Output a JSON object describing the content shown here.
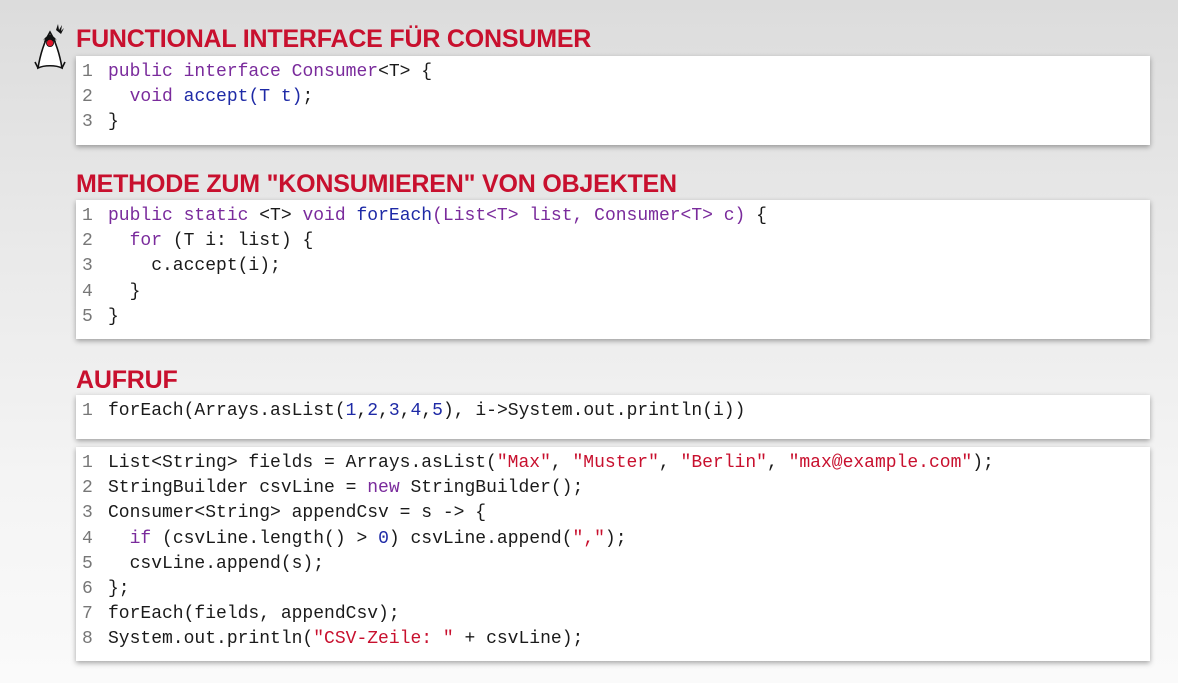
{
  "sections": [
    {
      "heading": "FUNCTIONAL INTERFACE FÜR CONSUMER",
      "blocks": [
        {
          "lines": [
            {
              "n": "1",
              "tokens": [
                [
                  "kw",
                  "public"
                ],
                [
                  "p",
                  " "
                ],
                [
                  "kw",
                  "interface"
                ],
                [
                  "p",
                  " "
                ],
                [
                  "ty",
                  "Consumer"
                ],
                [
                  "p",
                  "<T> {"
                ]
              ]
            },
            {
              "n": "2",
              "tokens": [
                [
                  "p",
                  "  "
                ],
                [
                  "kw",
                  "void"
                ],
                [
                  "p",
                  " "
                ],
                [
                  "fn",
                  "accept(T t)"
                ],
                [
                  "p",
                  ";"
                ]
              ]
            },
            {
              "n": "3",
              "tokens": [
                [
                  "p",
                  "}"
                ]
              ]
            }
          ]
        }
      ]
    },
    {
      "heading": "METHODE ZUM \"KONSUMIEREN\" VON OBJEKTEN",
      "blocks": [
        {
          "lines": [
            {
              "n": "1",
              "tokens": [
                [
                  "kw",
                  "public"
                ],
                [
                  "p",
                  " "
                ],
                [
                  "kw",
                  "static"
                ],
                [
                  "p",
                  " <T> "
                ],
                [
                  "kw",
                  "void"
                ],
                [
                  "p",
                  " "
                ],
                [
                  "fn",
                  "forEach"
                ],
                [
                  "ty",
                  "(List<T> list, Consumer<T> c)"
                ],
                [
                  "p",
                  " {"
                ]
              ]
            },
            {
              "n": "2",
              "tokens": [
                [
                  "p",
                  "  "
                ],
                [
                  "kw",
                  "for"
                ],
                [
                  "p",
                  " (T i: list) {"
                ]
              ]
            },
            {
              "n": "3",
              "tokens": [
                [
                  "p",
                  "    c.accept(i);"
                ]
              ]
            },
            {
              "n": "4",
              "tokens": [
                [
                  "p",
                  "  }"
                ]
              ]
            },
            {
              "n": "5",
              "tokens": [
                [
                  "p",
                  "}"
                ]
              ]
            }
          ]
        }
      ]
    },
    {
      "heading": "AUFRUF",
      "blocks": [
        {
          "lines": [
            {
              "n": "1",
              "tokens": [
                [
                  "p",
                  "forEach(Arrays.asList("
                ],
                [
                  "num",
                  "1"
                ],
                [
                  "p",
                  ","
                ],
                [
                  "num",
                  "2"
                ],
                [
                  "p",
                  ","
                ],
                [
                  "num",
                  "3"
                ],
                [
                  "p",
                  ","
                ],
                [
                  "num",
                  "4"
                ],
                [
                  "p",
                  ","
                ],
                [
                  "num",
                  "5"
                ],
                [
                  "p",
                  "), i->System.out.println(i))"
                ]
              ]
            }
          ]
        },
        {
          "lines": [
            {
              "n": "1",
              "tokens": [
                [
                  "p",
                  "List<String> fields = Arrays.asList("
                ],
                [
                  "str",
                  "\"Max\""
                ],
                [
                  "p",
                  ", "
                ],
                [
                  "str",
                  "\"Muster\""
                ],
                [
                  "p",
                  ", "
                ],
                [
                  "str",
                  "\"Berlin\""
                ],
                [
                  "p",
                  ", "
                ],
                [
                  "str",
                  "\"max@example.com\""
                ],
                [
                  "p",
                  ");"
                ]
              ]
            },
            {
              "n": "2",
              "tokens": [
                [
                  "p",
                  "StringBuilder csvLine = "
                ],
                [
                  "kw",
                  "new"
                ],
                [
                  "p",
                  " StringBuilder();"
                ]
              ]
            },
            {
              "n": "3",
              "tokens": [
                [
                  "p",
                  "Consumer<String> appendCsv = s -> {"
                ]
              ]
            },
            {
              "n": "4",
              "tokens": [
                [
                  "p",
                  "  "
                ],
                [
                  "kw",
                  "if"
                ],
                [
                  "p",
                  " (csvLine.length() > "
                ],
                [
                  "num",
                  "0"
                ],
                [
                  "p",
                  ") csvLine.append("
                ],
                [
                  "str",
                  "\",\""
                ],
                [
                  "p",
                  ");"
                ]
              ]
            },
            {
              "n": "5",
              "tokens": [
                [
                  "p",
                  "  csvLine.append(s);"
                ]
              ]
            },
            {
              "n": "6",
              "tokens": [
                [
                  "p",
                  "};"
                ]
              ]
            },
            {
              "n": "7",
              "tokens": [
                [
                  "p",
                  "forEach(fields, appendCsv);"
                ]
              ]
            },
            {
              "n": "8",
              "tokens": [
                [
                  "p",
                  "System.out.println("
                ],
                [
                  "str",
                  "\"CSV-Zeile: \""
                ],
                [
                  "p",
                  " + csvLine);"
                ]
              ]
            }
          ]
        }
      ]
    }
  ],
  "colors": {
    "heading": "#c8102e",
    "keyword": "#7a2b9c",
    "function": "#1e2aa6",
    "string": "#c8102e",
    "line_number": "#777777"
  },
  "logo_icon": "duke-mascot-icon"
}
